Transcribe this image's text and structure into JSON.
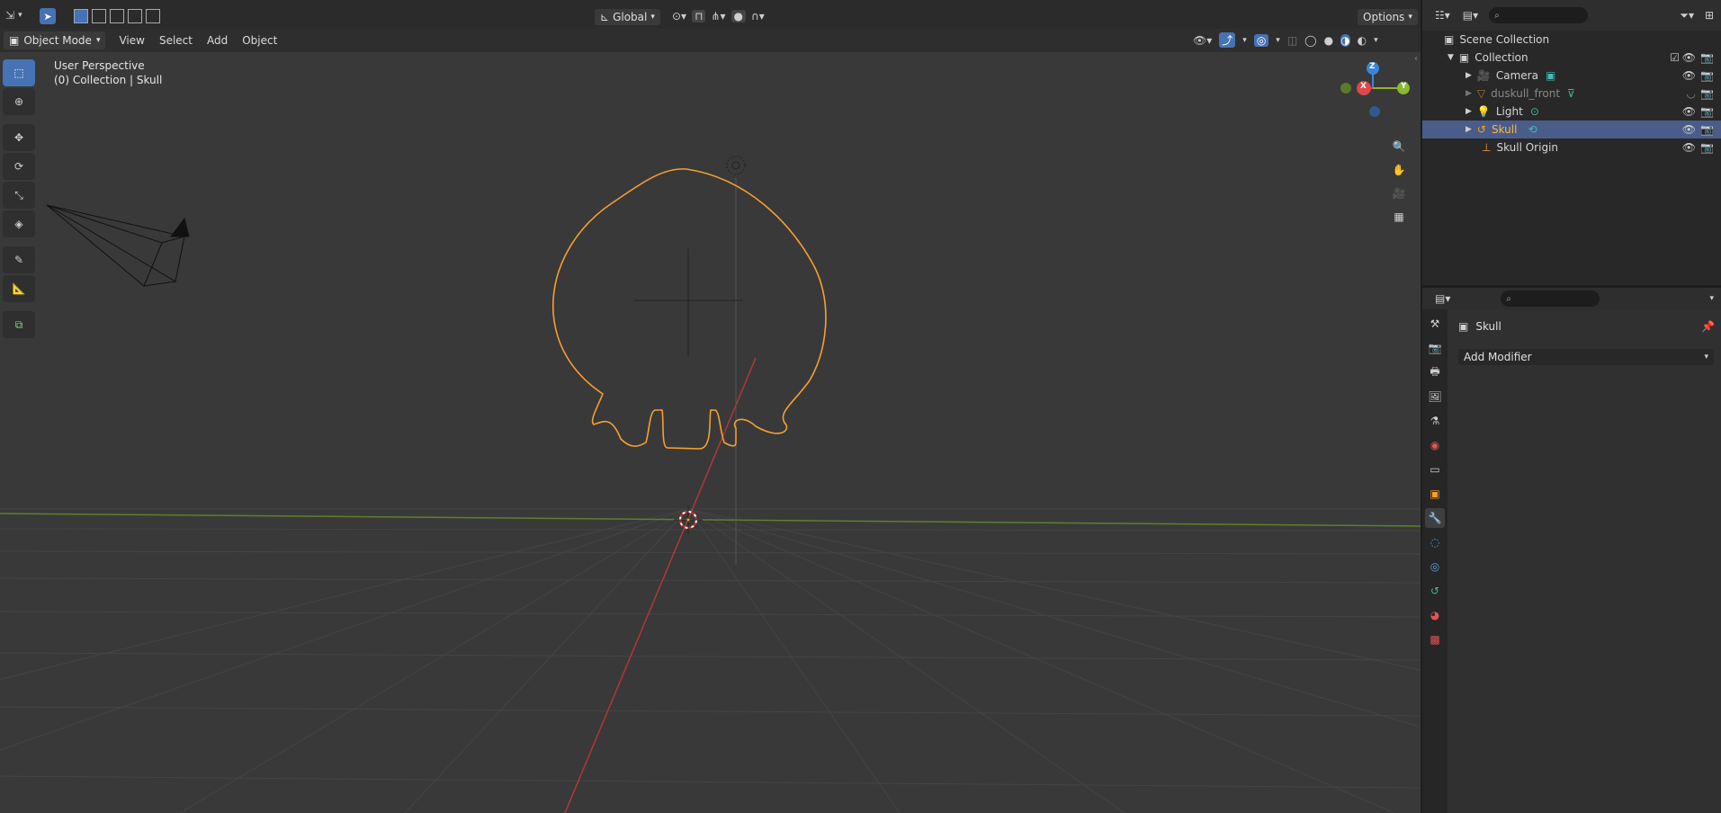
{
  "header": {
    "transform_orientation": "Global",
    "options_label": "Options"
  },
  "viewport_header": {
    "mode": "Object Mode",
    "menus": [
      "View",
      "Select",
      "Add",
      "Object"
    ]
  },
  "viewport": {
    "perspective_label": "User Perspective",
    "collection_label": "(0) Collection | Skull",
    "gizmo_axes": {
      "z": "Z",
      "x": "X",
      "y": "Y"
    }
  },
  "outliner": {
    "root": "Scene Collection",
    "collection": "Collection",
    "items": [
      {
        "name": "Camera",
        "icon": "camera-icon",
        "selected": false,
        "dimmed": false
      },
      {
        "name": "duskull_front",
        "icon": "mesh-icon",
        "selected": false,
        "dimmed": true
      },
      {
        "name": "Light",
        "icon": "light-icon",
        "selected": false,
        "dimmed": false
      },
      {
        "name": "Skull",
        "icon": "curve-icon",
        "selected": true,
        "dimmed": false
      },
      {
        "name": "Skull Origin",
        "icon": "empty-icon",
        "selected": false,
        "dimmed": false
      }
    ]
  },
  "properties": {
    "object_name": "Skull",
    "add_modifier_label": "Add Modifier"
  },
  "colors": {
    "accent": "#4772b3",
    "selection_orange": "#f5a030",
    "axis_x": "#e0474a",
    "axis_y": "#8ab82f",
    "axis_z": "#3b85d8"
  }
}
